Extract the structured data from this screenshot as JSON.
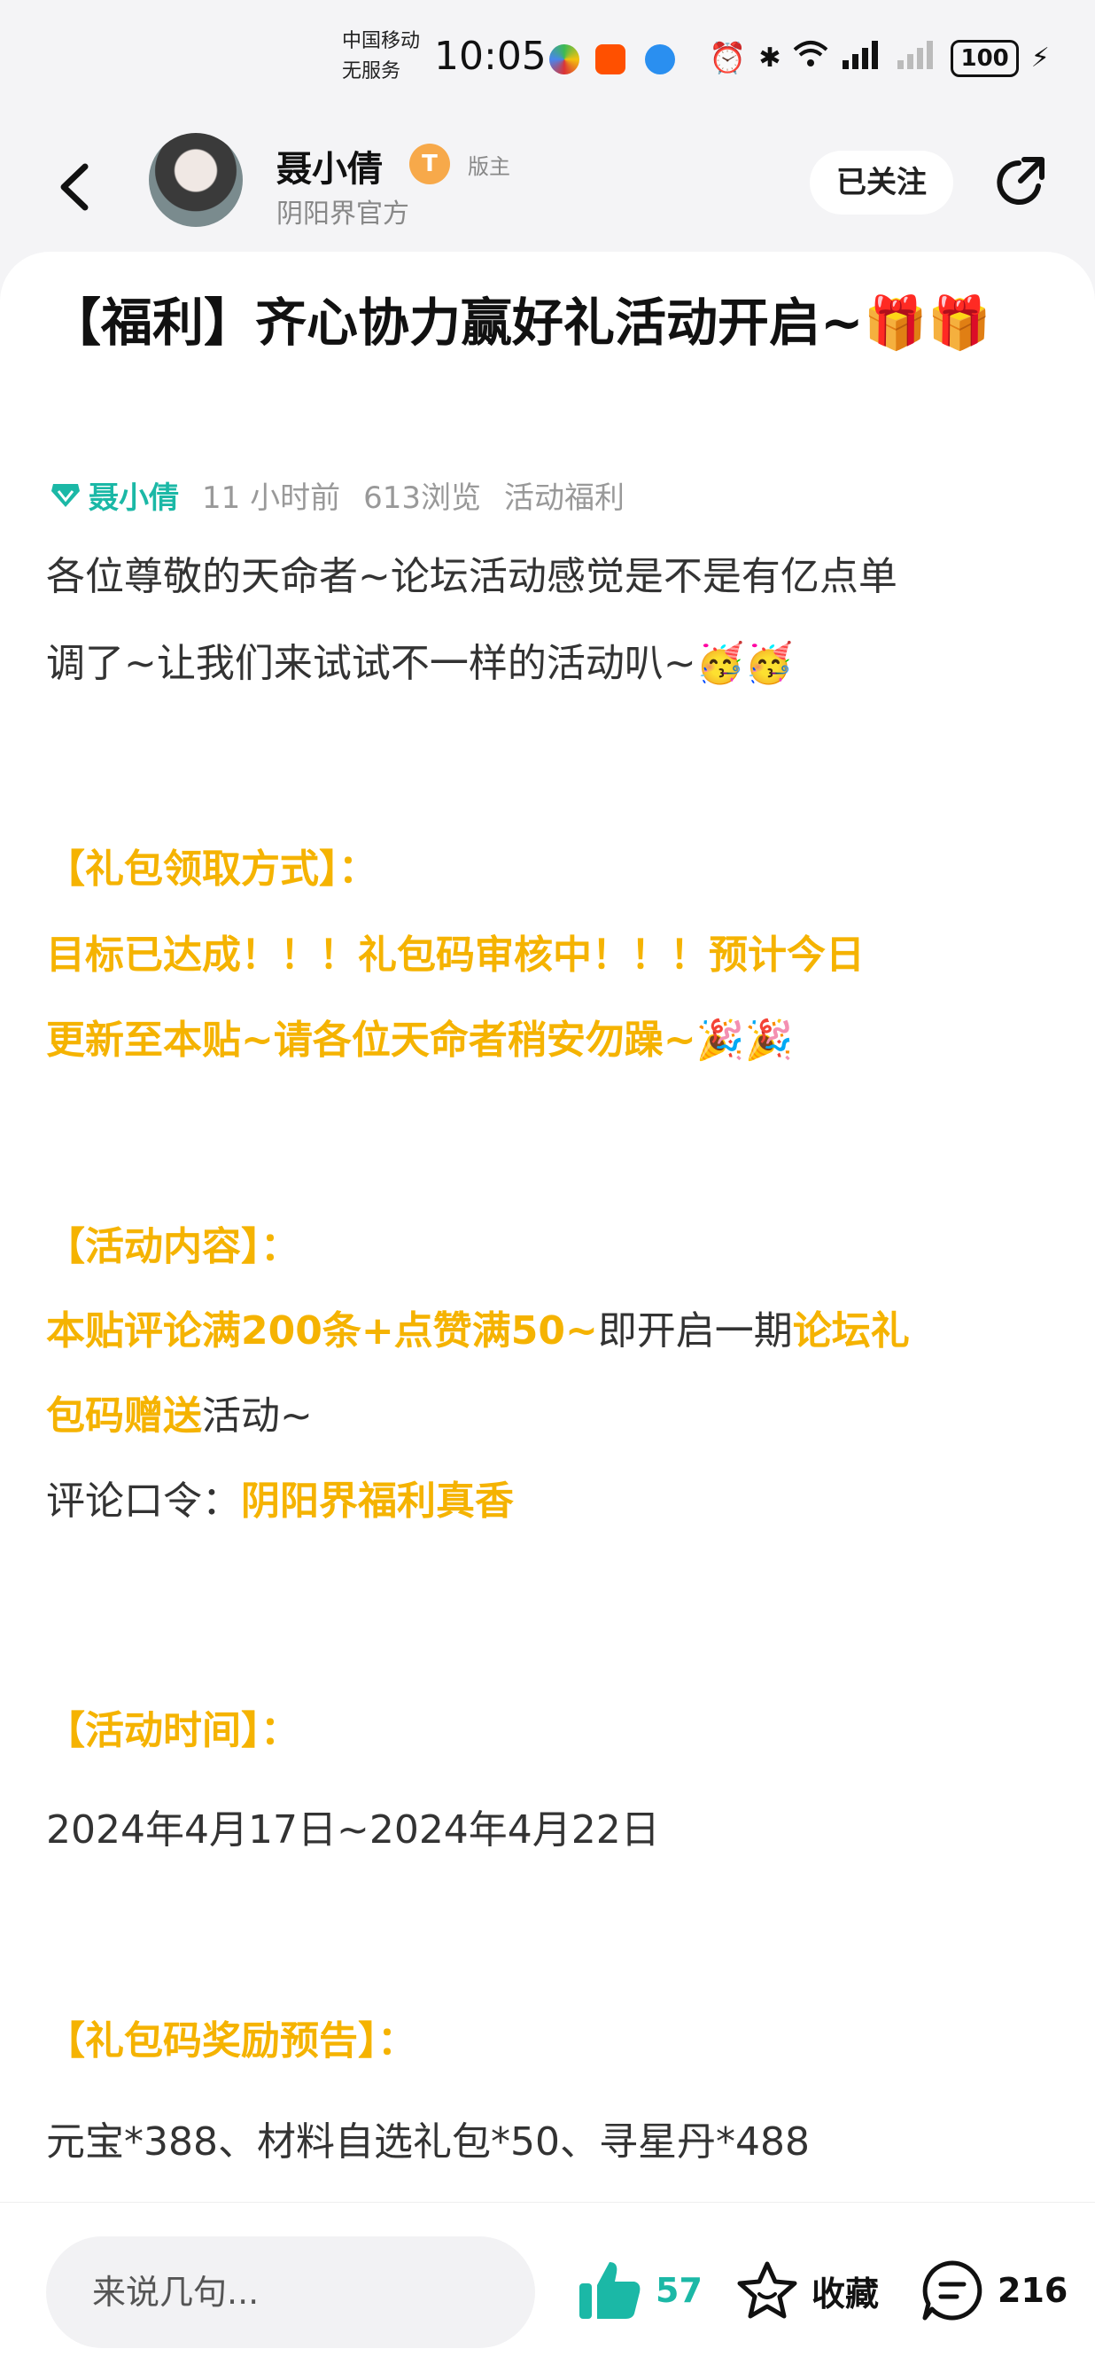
{
  "status": {
    "carrier_line1": "中国移动",
    "carrier_line2": "无服务",
    "time": "10:05",
    "battery": "100"
  },
  "header": {
    "author_name": "聂小倩",
    "level": "T",
    "role_tag": "版主",
    "author_sub": "阴阳界官方",
    "follow_label": "已关注"
  },
  "post": {
    "title": "【福利】齐心协力赢好礼活动开启~🎁🎁",
    "meta_user": "聂小倩",
    "meta_time": "11 小时前",
    "meta_views": "613浏览",
    "meta_category": "活动福利",
    "intro_a": "各位尊敬的天命者~论坛活动感觉是不是有亿点单",
    "intro_b": "调了~让我们来试试不一样的活动叭~🥳🥳",
    "sec1_title": "【礼包领取方式】：",
    "sec1_a": "目标已达成！！！礼包码审核中！！！预计今日",
    "sec1_b": "更新至本贴~请各位天命者稍安勿躁~🎉🎉",
    "sec2_title": "【活动内容】：",
    "sec2_a_hl1": "本贴评论满200条+点赞满50~",
    "sec2_a_plain": "即开启一期",
    "sec2_a_hl2": "论坛礼",
    "sec2_b_hl": "包码赠送",
    "sec2_b_plain": "活动~",
    "sec2_c_plain": "评论口令：",
    "sec2_c_hl": "阴阳界福利真香",
    "sec3_title": "【活动时间】：",
    "sec3_text": "2024年4月17日~2024年4月22日",
    "sec4_title": "【礼包码奖励预告】：",
    "sec4_text": "元宝*388、材料自选礼包*50、寻星丹*488"
  },
  "bottombar": {
    "comment_placeholder": "来说几句...",
    "like_count": "57",
    "fav_label": "收藏",
    "comment_count": "216"
  },
  "colors": {
    "accent_teal": "#1bb8a6",
    "highlight_orange": "#f5b301"
  }
}
